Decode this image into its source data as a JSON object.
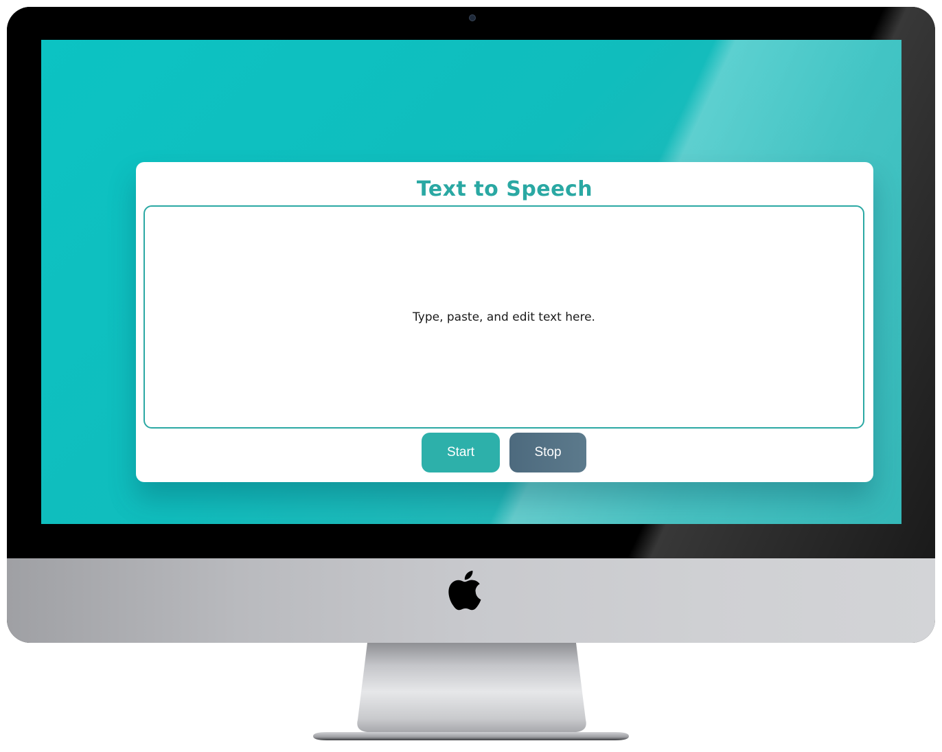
{
  "app": {
    "title": "Text to Speech",
    "textarea_placeholder": "Type, paste, and edit text here.",
    "textarea_value": ""
  },
  "controls": {
    "start_label": "Start",
    "stop_label": "Stop"
  },
  "device": {
    "logo_icon": "apple-logo-icon",
    "camera_icon": "camera-icon"
  },
  "colors": {
    "accent": "#2aa8a3",
    "start_button": "#2db0aa",
    "stop_button": "#557385",
    "screen_background": "#10bdbd"
  }
}
